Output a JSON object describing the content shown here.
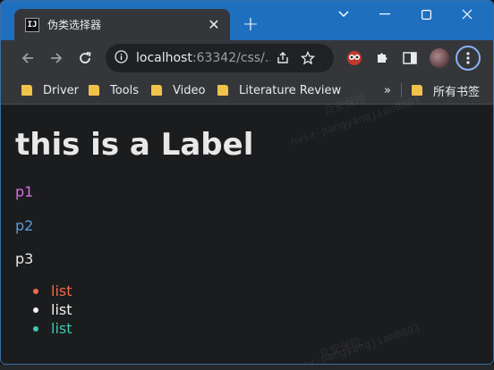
{
  "tab": {
    "favicon_text": "IJ",
    "title": "伪类选择器"
  },
  "omnibox": {
    "host": "localhost",
    "rest": ":63342/css/..."
  },
  "bookmarks": [
    {
      "label": "Driver"
    },
    {
      "label": "Tools"
    },
    {
      "label": "Video"
    },
    {
      "label": "Literature Review"
    }
  ],
  "bookmarks_other": "所有书签",
  "page": {
    "heading": "this is a Label",
    "paragraphs": [
      {
        "text": "p1",
        "color": "#d46fe0"
      },
      {
        "text": "p2",
        "color": "#5b9bd5"
      },
      {
        "text": "p3",
        "color": "#e8e8e8"
      }
    ],
    "list": [
      {
        "text": "list",
        "color": "#f06a4a"
      },
      {
        "text": "list",
        "color": "#f2f2f2"
      },
      {
        "text": "list",
        "color": "#3fc7b0"
      }
    ]
  },
  "watermark": {
    "text1": "众安保险",
    "text2": "nwsx-pangyangjian0803"
  },
  "colors": {
    "tabstrip": "#1f6fbf",
    "toolbar": "#35363a",
    "page_bg": "#1b1c1e",
    "accent": "#8ab4f8"
  }
}
